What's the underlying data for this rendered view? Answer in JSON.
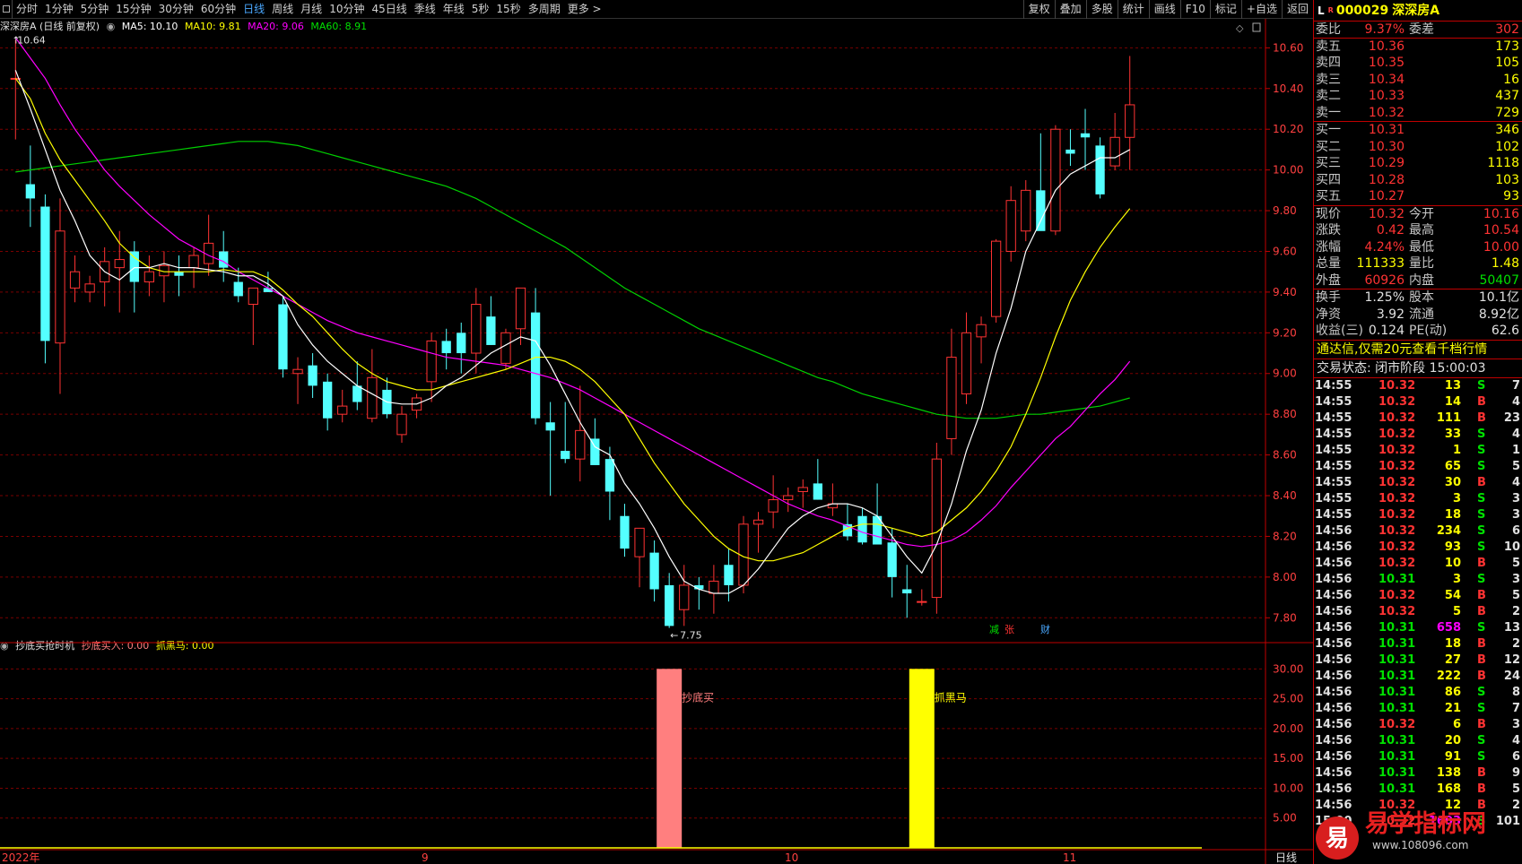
{
  "toolbar": {
    "periods": [
      "分时",
      "1分钟",
      "5分钟",
      "15分钟",
      "30分钟",
      "60分钟",
      "日线",
      "周线",
      "月线",
      "10分钟",
      "45日线",
      "季线",
      "年线",
      "5秒",
      "15秒",
      "多周期",
      "更多 >"
    ],
    "active": "日线",
    "tools": [
      "复权",
      "叠加",
      "多股",
      "统计",
      "画线",
      "F10",
      "标记",
      "+自选",
      "返回"
    ]
  },
  "chart_head": {
    "title": "深深房A (日线 前复权)",
    "ma5": "MA5: 10.10",
    "ma10": "MA10: 9.81",
    "ma20": "MA20: 9.06",
    "ma60": "MA60: 8.91"
  },
  "colors": {
    "up": "#ff3333",
    "down": "#54ffff",
    "ma5": "#ffffff",
    "ma10": "#ffff00",
    "ma20": "#ff00ff",
    "ma60": "#00d000",
    "grid": "#7a0000",
    "axis": "#c00000",
    "buy_bar": "#ff7f7f",
    "horse_bar": "#ffff00"
  },
  "sub_head": {
    "name": "抄底买抢时机",
    "buy": "抄底买入: 0.00",
    "horse": "抓黑马: 0.00"
  },
  "chart_data": [
    {
      "type": "candlestick",
      "title": "深深房A (日线 前复权)",
      "ylim": [
        7.7,
        10.65
      ],
      "y_ticks": [
        "10.60",
        "10.40",
        "10.20",
        "10.00",
        "9.80",
        "9.60",
        "9.40",
        "9.20",
        "9.00",
        "8.80",
        "8.60",
        "8.40",
        "8.20",
        "8.00",
        "7.80"
      ],
      "x_labels": [
        "2022年",
        "9",
        "10",
        "11"
      ],
      "high_label": "10.64",
      "low_label": "7.75",
      "ohlc": [
        [
          10.45,
          10.64,
          10.15,
          10.45
        ],
        [
          9.93,
          10.12,
          9.72,
          9.86
        ],
        [
          9.82,
          9.88,
          9.05,
          9.16
        ],
        [
          9.15,
          9.86,
          8.9,
          9.7
        ],
        [
          9.42,
          9.58,
          9.35,
          9.5
        ],
        [
          9.4,
          9.48,
          9.35,
          9.44
        ],
        [
          9.45,
          9.62,
          9.33,
          9.55
        ],
        [
          9.52,
          9.7,
          9.3,
          9.56
        ],
        [
          9.6,
          9.65,
          9.3,
          9.45
        ],
        [
          9.45,
          9.58,
          9.38,
          9.5
        ],
        [
          9.48,
          9.6,
          9.35,
          9.53
        ],
        [
          9.5,
          9.58,
          9.38,
          9.48
        ],
        [
          9.52,
          9.62,
          9.42,
          9.58
        ],
        [
          9.54,
          9.78,
          9.48,
          9.64
        ],
        [
          9.6,
          9.7,
          9.45,
          9.52
        ],
        [
          9.45,
          9.52,
          9.35,
          9.38
        ],
        [
          9.34,
          9.42,
          9.14,
          9.42
        ],
        [
          9.42,
          9.5,
          9.4,
          9.4
        ],
        [
          9.34,
          9.38,
          8.98,
          9.02
        ],
        [
          9.0,
          9.08,
          8.85,
          9.02
        ],
        [
          9.04,
          9.1,
          8.88,
          8.94
        ],
        [
          8.96,
          9.0,
          8.72,
          8.78
        ],
        [
          8.8,
          8.92,
          8.76,
          8.84
        ],
        [
          8.94,
          9.06,
          8.82,
          8.86
        ],
        [
          8.78,
          9.12,
          8.76,
          8.98
        ],
        [
          8.92,
          8.98,
          8.78,
          8.8
        ],
        [
          8.7,
          8.84,
          8.66,
          8.8
        ],
        [
          8.82,
          8.9,
          8.78,
          8.88
        ],
        [
          8.96,
          9.2,
          8.86,
          9.16
        ],
        [
          9.16,
          9.22,
          9.02,
          9.1
        ],
        [
          9.2,
          9.25,
          9.0,
          9.1
        ],
        [
          9.1,
          9.42,
          9.0,
          9.34
        ],
        [
          9.28,
          9.38,
          9.14,
          9.14
        ],
        [
          9.05,
          9.22,
          9.02,
          9.2
        ],
        [
          9.22,
          9.42,
          9.14,
          9.42
        ],
        [
          9.3,
          9.42,
          8.75,
          8.78
        ],
        [
          8.76,
          8.86,
          8.4,
          8.72
        ],
        [
          8.62,
          8.86,
          8.56,
          8.58
        ],
        [
          8.58,
          8.94,
          8.47,
          8.72
        ],
        [
          8.68,
          8.78,
          8.55,
          8.55
        ],
        [
          8.58,
          8.64,
          8.28,
          8.42
        ],
        [
          8.3,
          8.36,
          8.1,
          8.14
        ],
        [
          8.1,
          8.22,
          7.95,
          8.24
        ],
        [
          8.12,
          8.18,
          7.88,
          7.94
        ],
        [
          7.96,
          8.02,
          7.75,
          7.76
        ],
        [
          7.84,
          8.06,
          7.76,
          7.96
        ],
        [
          7.96,
          8.0,
          7.84,
          7.94
        ],
        [
          7.92,
          8.06,
          7.82,
          7.98
        ],
        [
          8.06,
          8.14,
          7.88,
          7.96
        ],
        [
          7.96,
          8.3,
          7.92,
          8.26
        ],
        [
          8.26,
          8.32,
          8.12,
          8.28
        ],
        [
          8.32,
          8.5,
          8.24,
          8.38
        ],
        [
          8.38,
          8.44,
          8.32,
          8.4
        ],
        [
          8.42,
          8.48,
          8.34,
          8.44
        ],
        [
          8.46,
          8.58,
          8.38,
          8.38
        ],
        [
          8.34,
          8.46,
          8.3,
          8.36
        ],
        [
          8.26,
          8.36,
          8.18,
          8.2
        ],
        [
          8.3,
          8.34,
          8.16,
          8.17
        ],
        [
          8.3,
          8.46,
          8.2,
          8.16
        ],
        [
          8.17,
          8.24,
          7.9,
          8.0
        ],
        [
          7.94,
          8.06,
          7.8,
          7.92
        ],
        [
          7.88,
          7.94,
          7.86,
          7.88
        ],
        [
          7.9,
          8.66,
          7.82,
          8.58
        ],
        [
          8.68,
          9.22,
          8.6,
          9.08
        ],
        [
          8.9,
          9.3,
          8.85,
          9.2
        ],
        [
          9.18,
          9.28,
          9.05,
          9.24
        ],
        [
          9.28,
          9.66,
          9.25,
          9.65
        ],
        [
          9.6,
          9.92,
          9.55,
          9.85
        ],
        [
          9.7,
          9.95,
          9.65,
          9.9
        ],
        [
          9.9,
          10.18,
          9.85,
          9.7
        ],
        [
          9.7,
          10.22,
          9.68,
          10.2
        ],
        [
          10.1,
          10.2,
          10.02,
          10.08
        ],
        [
          10.18,
          10.3,
          10.0,
          10.16
        ],
        [
          10.12,
          10.16,
          9.86,
          9.88
        ],
        [
          10.02,
          10.28,
          10.0,
          10.16
        ],
        [
          10.16,
          10.56,
          10.0,
          10.32
        ]
      ],
      "ma5": [
        10.49,
        10.3,
        10.1,
        9.9,
        9.75,
        9.58,
        9.5,
        9.46,
        9.52,
        9.52,
        9.54,
        9.52,
        9.52,
        9.51,
        9.5,
        9.48,
        9.48,
        9.44,
        9.38,
        9.24,
        9.14,
        9.06,
        9.0,
        8.94,
        8.9,
        8.86,
        8.85,
        8.85,
        8.88,
        8.94,
        8.98,
        9.04,
        9.1,
        9.14,
        9.18,
        9.16,
        9.04,
        8.9,
        8.76,
        8.64,
        8.6,
        8.46,
        8.36,
        8.24,
        8.1,
        7.98,
        7.94,
        7.92,
        7.92,
        7.96,
        8.04,
        8.14,
        8.24,
        8.3,
        8.34,
        8.36,
        8.36,
        8.34,
        8.3,
        8.2,
        8.1,
        8.02,
        8.16,
        8.36,
        8.62,
        8.82,
        9.1,
        9.32,
        9.6,
        9.75,
        9.9,
        9.98,
        10.02,
        10.06,
        10.06,
        10.1
      ],
      "ma10": [
        10.45,
        10.35,
        10.18,
        10.05,
        9.95,
        9.85,
        9.75,
        9.64,
        9.57,
        9.52,
        9.5,
        9.5,
        9.5,
        9.5,
        9.51,
        9.5,
        9.5,
        9.47,
        9.41,
        9.34,
        9.28,
        9.2,
        9.12,
        9.05,
        9.0,
        8.96,
        8.94,
        8.92,
        8.92,
        8.94,
        8.96,
        8.98,
        9.0,
        9.02,
        9.05,
        9.08,
        9.08,
        9.06,
        9.02,
        8.96,
        8.88,
        8.8,
        8.68,
        8.56,
        8.46,
        8.36,
        8.28,
        8.2,
        8.14,
        8.1,
        8.08,
        8.08,
        8.1,
        8.12,
        8.16,
        8.2,
        8.24,
        8.26,
        8.26,
        8.24,
        8.22,
        8.2,
        8.22,
        8.28,
        8.34,
        8.42,
        8.52,
        8.64,
        8.8,
        8.98,
        9.18,
        9.36,
        9.5,
        9.62,
        9.72,
        9.81
      ],
      "ma20": [
        10.65,
        10.55,
        10.45,
        10.32,
        10.2,
        10.1,
        10.0,
        9.92,
        9.85,
        9.78,
        9.72,
        9.66,
        9.62,
        9.58,
        9.55,
        9.5,
        9.46,
        9.42,
        9.38,
        9.34,
        9.3,
        9.26,
        9.23,
        9.2,
        9.18,
        9.16,
        9.14,
        9.12,
        9.1,
        9.08,
        9.07,
        9.06,
        9.05,
        9.04,
        9.02,
        9.0,
        8.98,
        8.95,
        8.92,
        8.88,
        8.84,
        8.8,
        8.76,
        8.72,
        8.68,
        8.64,
        8.6,
        8.56,
        8.52,
        8.48,
        8.44,
        8.4,
        8.36,
        8.33,
        8.3,
        8.28,
        8.25,
        8.22,
        8.2,
        8.18,
        8.16,
        8.15,
        8.16,
        8.18,
        8.22,
        8.28,
        8.35,
        8.44,
        8.52,
        8.6,
        8.68,
        8.74,
        8.82,
        8.9,
        8.97,
        9.06
      ],
      "ma60": [
        9.99,
        10.0,
        10.01,
        10.02,
        10.03,
        10.04,
        10.05,
        10.06,
        10.07,
        10.08,
        10.09,
        10.1,
        10.11,
        10.12,
        10.13,
        10.14,
        10.14,
        10.14,
        10.13,
        10.12,
        10.1,
        10.08,
        10.06,
        10.04,
        10.02,
        10.0,
        9.98,
        9.96,
        9.94,
        9.92,
        9.89,
        9.86,
        9.82,
        9.78,
        9.74,
        9.7,
        9.66,
        9.62,
        9.57,
        9.52,
        9.47,
        9.42,
        9.38,
        9.34,
        9.3,
        9.26,
        9.22,
        9.19,
        9.16,
        9.13,
        9.1,
        9.07,
        9.04,
        9.01,
        8.98,
        8.96,
        8.93,
        8.9,
        8.88,
        8.86,
        8.84,
        8.82,
        8.8,
        8.79,
        8.78,
        8.78,
        8.78,
        8.79,
        8.8,
        8.8,
        8.81,
        8.82,
        8.83,
        8.84,
        8.86,
        8.88
      ],
      "markers": [
        "减",
        "张",
        "财"
      ]
    },
    {
      "type": "bar",
      "title": "抄底买抢时机",
      "ylim": [
        0,
        32
      ],
      "y_ticks": [
        "30.00",
        "25.00",
        "20.00",
        "15.00",
        "10.00",
        "5.00"
      ],
      "series": [
        {
          "name": "抄底买入",
          "index": 44,
          "value": 30,
          "label": "抄底买"
        },
        {
          "name": "抓黑马",
          "index": 61,
          "value": 30,
          "label": "抓黑马"
        }
      ]
    }
  ],
  "bottom": {
    "period": "日线"
  },
  "panel": {
    "header": {
      "l": "L",
      "r": "R",
      "code": "000029",
      "name": "深深房A"
    },
    "weibi": {
      "label": "委比",
      "value": "9.37%",
      "label2": "委差",
      "value2": "302"
    },
    "asks": [
      {
        "label": "卖五",
        "price": "10.36",
        "vol": "173"
      },
      {
        "label": "卖四",
        "price": "10.35",
        "vol": "105"
      },
      {
        "label": "卖三",
        "price": "10.34",
        "vol": "16"
      },
      {
        "label": "卖二",
        "price": "10.33",
        "vol": "437"
      },
      {
        "label": "卖一",
        "price": "10.32",
        "vol": "729"
      }
    ],
    "bids": [
      {
        "label": "买一",
        "price": "10.31",
        "vol": "346"
      },
      {
        "label": "买二",
        "price": "10.30",
        "vol": "102"
      },
      {
        "label": "买三",
        "price": "10.29",
        "vol": "1118"
      },
      {
        "label": "买四",
        "price": "10.28",
        "vol": "103"
      },
      {
        "label": "买五",
        "price": "10.27",
        "vol": "93"
      }
    ],
    "quote": [
      {
        "l1": "现价",
        "v1": "10.32",
        "c1": "red",
        "l2": "今开",
        "v2": "10.16",
        "c2": "red"
      },
      {
        "l1": "涨跌",
        "v1": "0.42",
        "c1": "red",
        "l2": "最高",
        "v2": "10.54",
        "c2": "red"
      },
      {
        "l1": "涨幅",
        "v1": "4.24%",
        "c1": "red",
        "l2": "最低",
        "v2": "10.00",
        "c2": "red"
      },
      {
        "l1": "总量",
        "v1": "111333",
        "c1": "yellow",
        "l2": "量比",
        "v2": "1.48",
        "c2": "yellow"
      },
      {
        "l1": "外盘",
        "v1": "60926",
        "c1": "red",
        "l2": "内盘",
        "v2": "50407",
        "c2": "green"
      }
    ],
    "fund": [
      {
        "l1": "换手",
        "v1": "1.25%",
        "l2": "股本",
        "v2": "10.1亿"
      },
      {
        "l1": "净资",
        "v1": "3.92",
        "l2": "流通",
        "v2": "8.92亿"
      },
      {
        "l1": "收益(三)",
        "v1": "0.124",
        "l2": "PE(动)",
        "v2": "62.6"
      }
    ],
    "notice": "通达信,仅需20元查看千档行情",
    "status": "交易状态: 闭市阶段 15:00:03",
    "ticks": [
      [
        "14:55",
        "10.32",
        "13",
        "S",
        "7"
      ],
      [
        "14:55",
        "10.32",
        "14",
        "B",
        "4"
      ],
      [
        "14:55",
        "10.32",
        "111",
        "B",
        "23"
      ],
      [
        "14:55",
        "10.32",
        "33",
        "S",
        "4"
      ],
      [
        "14:55",
        "10.32",
        "1",
        "S",
        "1"
      ],
      [
        "14:55",
        "10.32",
        "65",
        "S",
        "5"
      ],
      [
        "14:55",
        "10.32",
        "30",
        "B",
        "4"
      ],
      [
        "14:55",
        "10.32",
        "3",
        "S",
        "3"
      ],
      [
        "14:55",
        "10.32",
        "18",
        "S",
        "3"
      ],
      [
        "14:56",
        "10.32",
        "234",
        "S",
        "6"
      ],
      [
        "14:56",
        "10.32",
        "93",
        "S",
        "10"
      ],
      [
        "14:56",
        "10.32",
        "10",
        "B",
        "5"
      ],
      [
        "14:56",
        "10.31",
        "3",
        "S",
        "3"
      ],
      [
        "14:56",
        "10.32",
        "54",
        "B",
        "5"
      ],
      [
        "14:56",
        "10.32",
        "5",
        "B",
        "2"
      ],
      [
        "14:56",
        "10.31",
        "658",
        "S",
        "13"
      ],
      [
        "14:56",
        "10.31",
        "18",
        "B",
        "2"
      ],
      [
        "14:56",
        "10.31",
        "27",
        "B",
        "12"
      ],
      [
        "14:56",
        "10.31",
        "222",
        "B",
        "24"
      ],
      [
        "14:56",
        "10.31",
        "86",
        "S",
        "8"
      ],
      [
        "14:56",
        "10.31",
        "21",
        "S",
        "7"
      ],
      [
        "14:56",
        "10.32",
        "6",
        "B",
        "3"
      ],
      [
        "14:56",
        "10.31",
        "20",
        "S",
        "4"
      ],
      [
        "14:56",
        "10.31",
        "91",
        "S",
        "6"
      ],
      [
        "14:56",
        "10.31",
        "138",
        "B",
        "9"
      ],
      [
        "14:56",
        "10.31",
        "168",
        "B",
        "5"
      ],
      [
        "14:56",
        "10.32",
        "12",
        "B",
        "2"
      ],
      [
        "15:00",
        "10.32",
        "1603",
        "S",
        "101"
      ]
    ]
  },
  "watermark": {
    "badge": "易",
    "title": "易学指标网",
    "url": "www.108096.com"
  }
}
